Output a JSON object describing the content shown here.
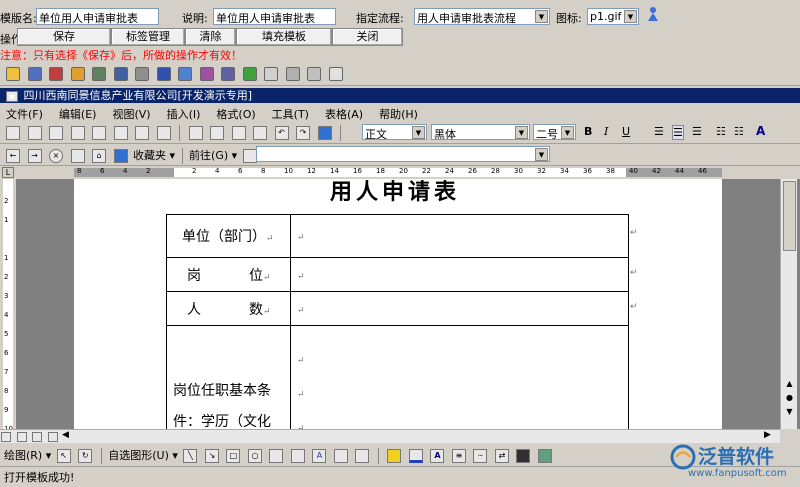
{
  "form": {
    "template_name_label": "模版名:",
    "template_name_value": "单位用人申请审批表",
    "desc_label": "说明:",
    "desc_value": "单位用人申请审批表",
    "flow_label": "指定流程:",
    "flow_value": "用人申请审批表流程",
    "icon_label": "图标:",
    "icon_value": "p1.gif",
    "op_label": "操作:",
    "buttons": [
      "保存",
      "标签管理",
      "清除",
      "填充模板",
      "关闭"
    ],
    "warning": "注意：只有选择《保存》后，所做的操作才有效！"
  },
  "word": {
    "title_bar": "四川西南同景信息产业有限公司[开发演示专用]",
    "menus": [
      "文件(F)",
      "编辑(E)",
      "视图(V)",
      "插入(I)",
      "格式(O)",
      "工具(T)",
      "表格(A)",
      "帮助(H)"
    ],
    "style_value": "正文",
    "font_value": "黑体",
    "size_value": "二号",
    "bold": "B",
    "italic": "I",
    "underline": "U",
    "fav_label": "收藏夹",
    "goto_label": "前往(G)",
    "ruler_ticks": [
      "8",
      "6",
      "4",
      "2",
      "",
      "2",
      "4",
      "6",
      "8",
      "10",
      "12",
      "14",
      "16",
      "18",
      "20",
      "22",
      "24",
      "26",
      "28",
      "30",
      "32",
      "34",
      "36",
      "38",
      "40",
      "42",
      "44",
      "46"
    ],
    "vruler_ticks": [
      "2",
      "1",
      "",
      "1",
      "2",
      "3",
      "4",
      "5",
      "6",
      "7",
      "8",
      "9",
      "10"
    ],
    "doc_title": "用人申请表",
    "table_rows": [
      {
        "label": "单位（部门）"
      },
      {
        "label_a": "岗",
        "label_b": "位"
      },
      {
        "label_a": "人",
        "label_b": "数"
      }
    ],
    "long_cell_line1": "岗位任职基本条",
    "long_cell_line2": "件：学历（文化",
    "draw_label": "绘图(R)",
    "autoshape_label": "自选图形(U)",
    "status_text": "打开模板成功!",
    "watermark_brand": "泛普软件",
    "watermark_url": "www.fanpusoft.com"
  },
  "colors": {
    "title_bar": "#0a246a",
    "warning_text": "#ff0000",
    "brand_blue": "#2a6fb5"
  }
}
